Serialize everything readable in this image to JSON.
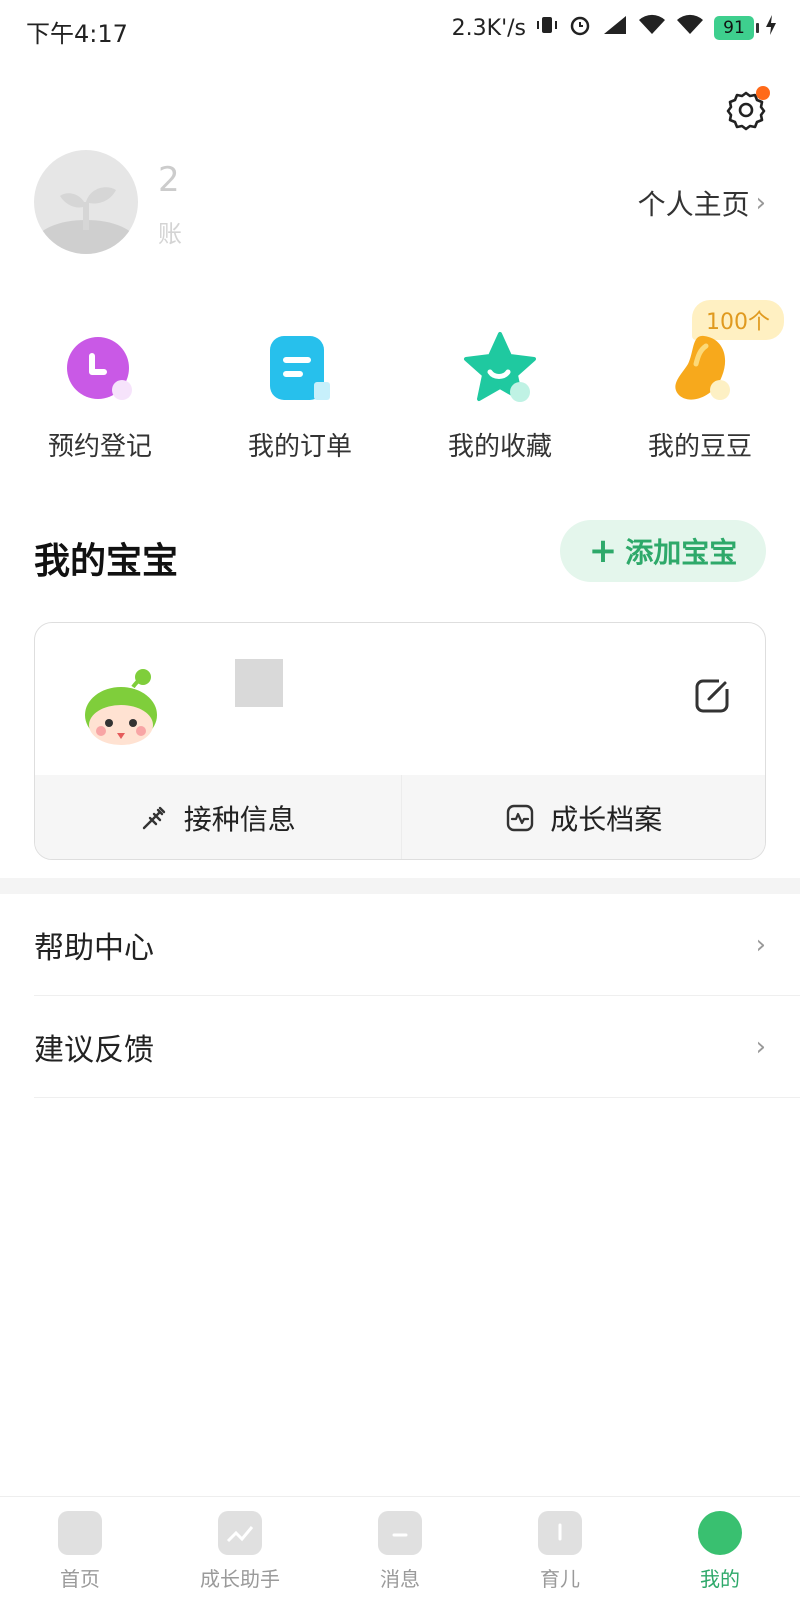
{
  "status_bar": {
    "time": "下午4:17",
    "speed": "2.3K'/s",
    "battery": "91"
  },
  "profile": {
    "name": "2",
    "account": "账",
    "homepage_link": "个人主页"
  },
  "quick_menu": {
    "items": [
      {
        "label": "预约登记",
        "icon": "clock-icon",
        "color": "#c04fe0"
      },
      {
        "label": "我的订单",
        "icon": "order-icon",
        "color": "#1fb9e8"
      },
      {
        "label": "我的收藏",
        "icon": "star-icon",
        "color": "#1fc49a"
      },
      {
        "label": "我的豆豆",
        "icon": "bean-icon",
        "color": "#f5a21a"
      }
    ],
    "beans_badge": "100个"
  },
  "baby_section": {
    "title": "我的宝宝",
    "add_button": "添加宝宝",
    "card": {
      "vaccination": "接种信息",
      "growth_record": "成长档案"
    }
  },
  "list": {
    "items": [
      {
        "label": "帮助中心"
      },
      {
        "label": "建议反馈"
      }
    ]
  },
  "tab_bar": {
    "tabs": [
      {
        "label": "首页",
        "active": false
      },
      {
        "label": "成长助手",
        "active": false
      },
      {
        "label": "消息",
        "active": false
      },
      {
        "label": "育儿",
        "active": false
      },
      {
        "label": "我的",
        "active": true
      }
    ]
  },
  "colors": {
    "accent_green": "#2ea96a",
    "notification_dot": "#ff6a1a",
    "add_button_bg": "#e4f6ec"
  }
}
